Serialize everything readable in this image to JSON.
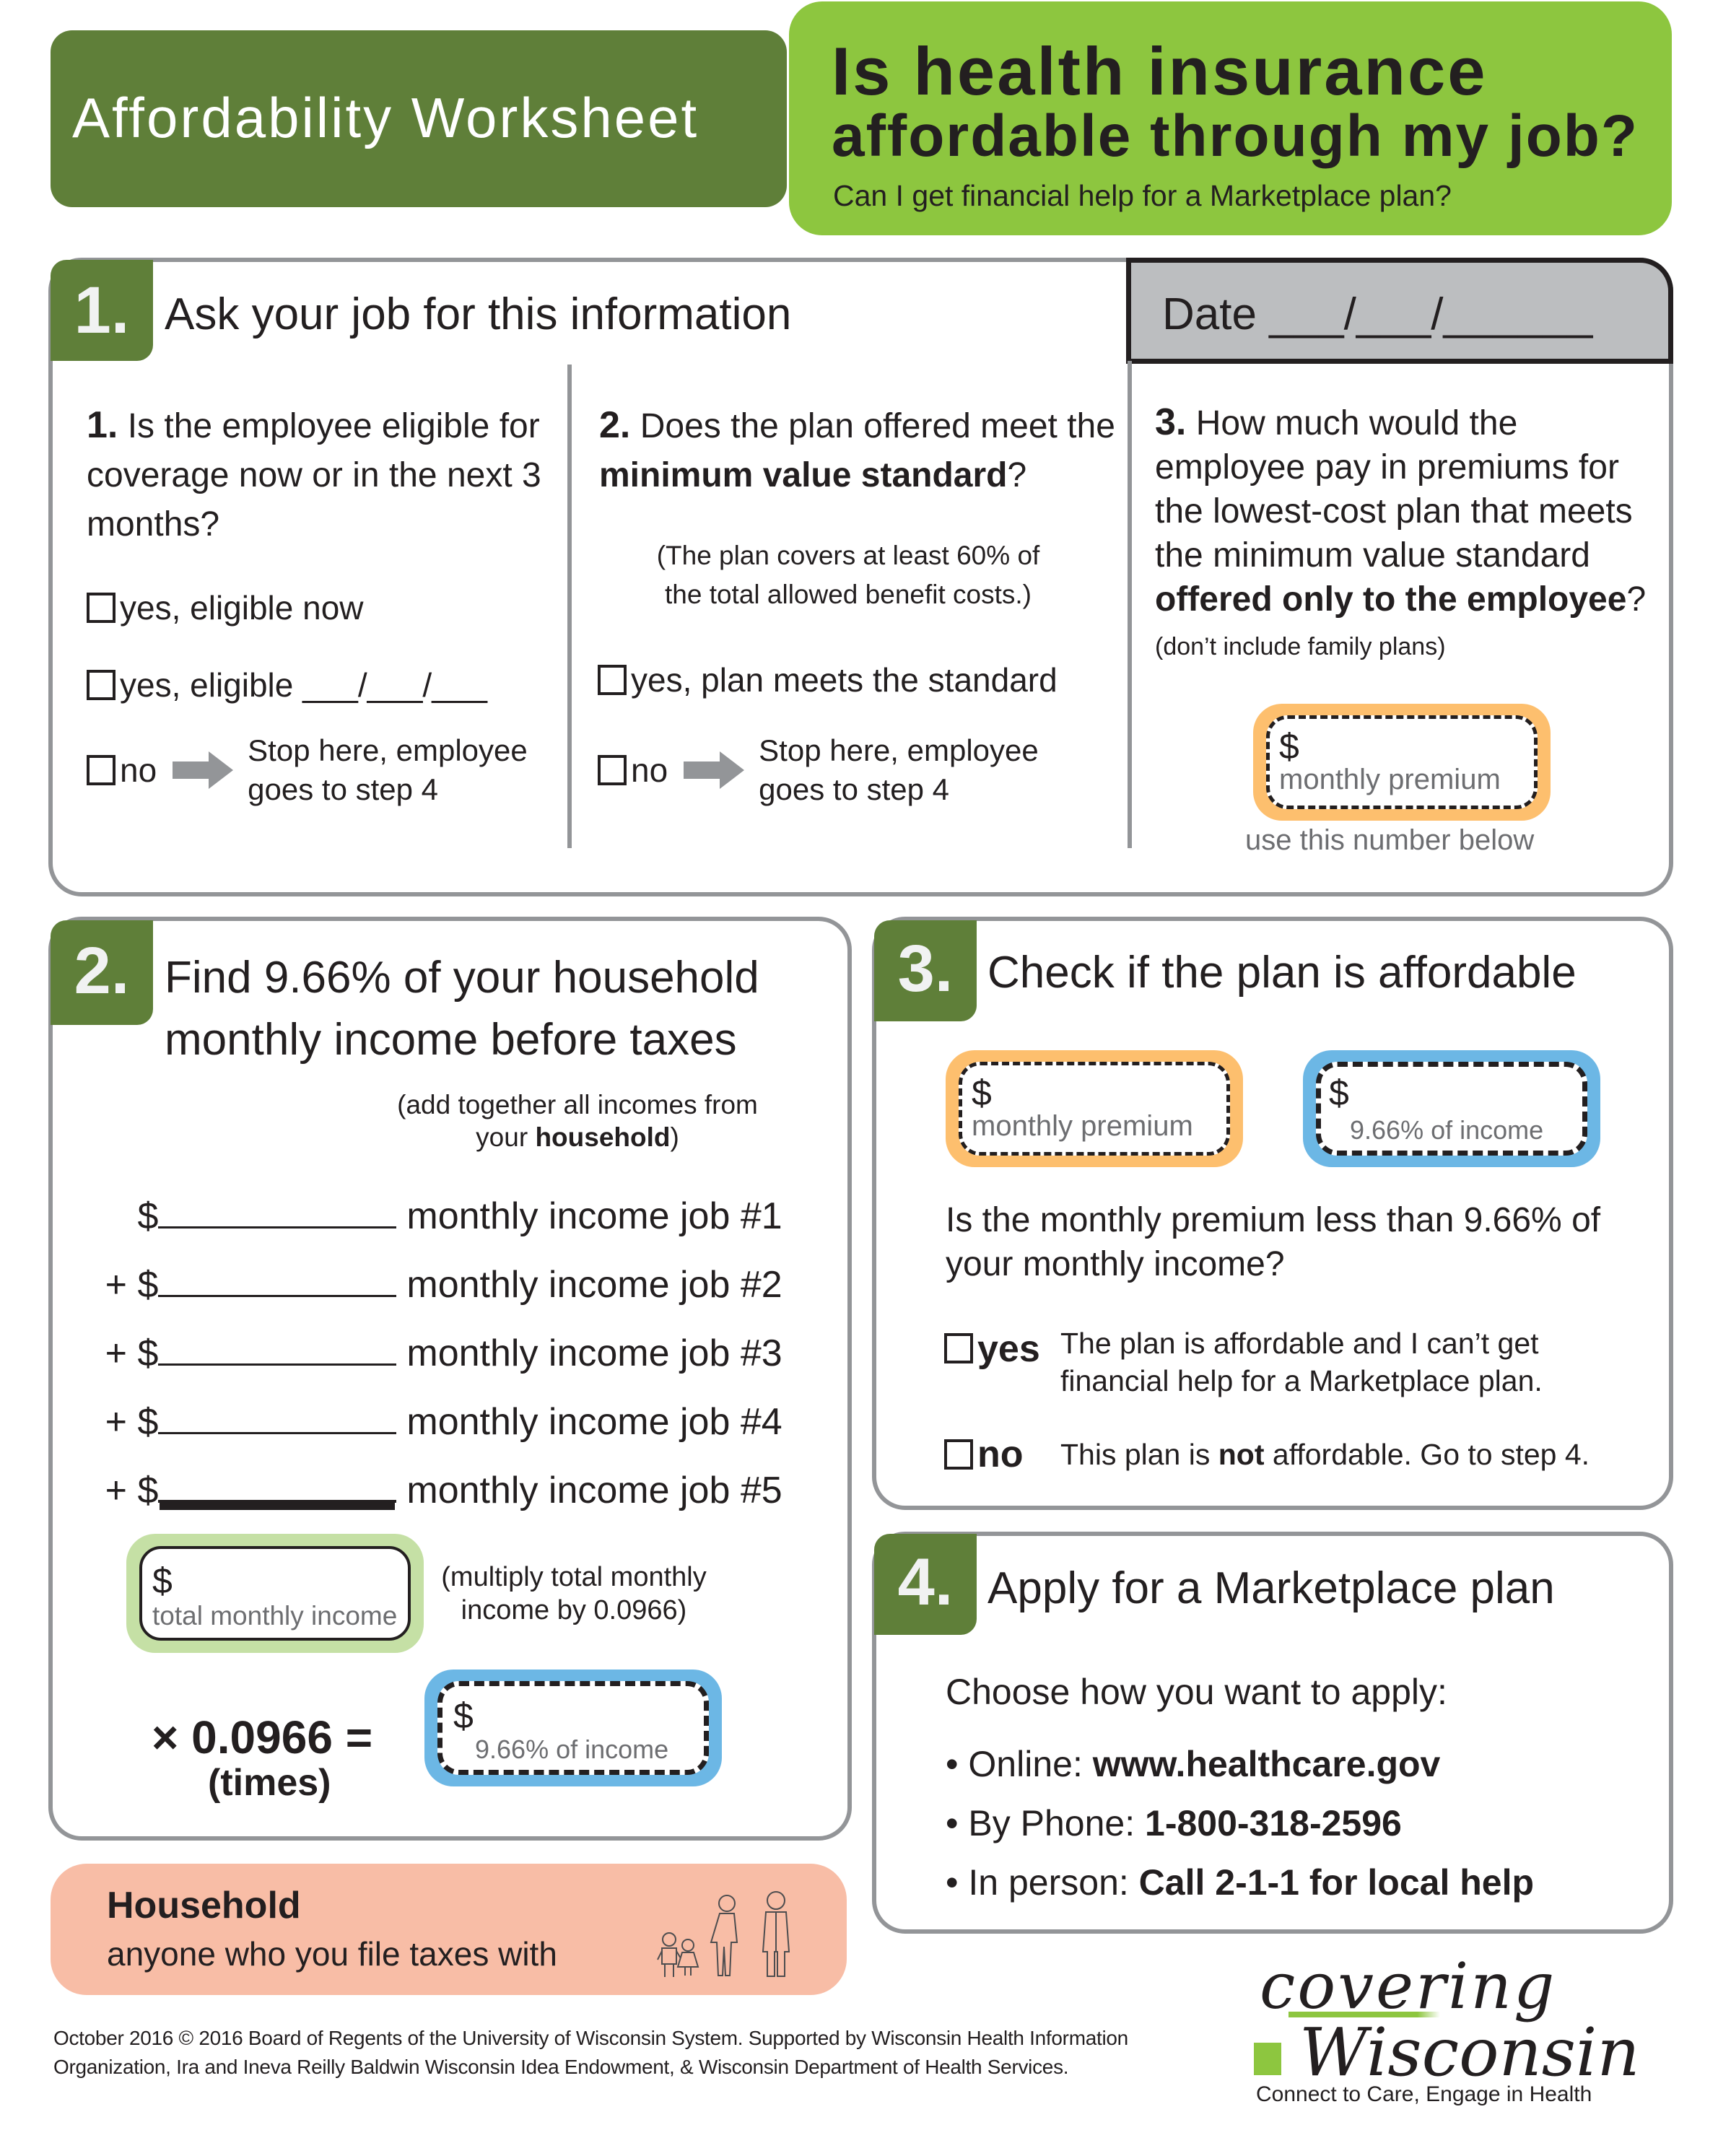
{
  "header": {
    "worksheet_title": "Affordability Worksheet",
    "question_line1": "Is health insurance",
    "question_line2": "affordable through my job?",
    "subtitle": "Can I get financial help for a Marketplace plan?"
  },
  "colors": {
    "dark_green": "#5f7f39",
    "light_green": "#8dc63f",
    "orange": "#fdbf6e",
    "blue": "#6cb7e5",
    "pale_green": "#c5e0a5",
    "salmon": "#f8bda6",
    "gray_border": "#939598",
    "date_gray": "#bcbec0"
  },
  "step1": {
    "number": "1.",
    "title": "Ask your job for this information",
    "date_label": "Date ___/___/______",
    "q1": {
      "num": "1.",
      "text": "Is the employee eligible for coverage now or in the next 3 months?",
      "options": [
        "yes, eligible now",
        "yes, eligible ___/___/___",
        "no"
      ],
      "stop_text": "Stop here, employee goes to step 4"
    },
    "q2": {
      "num": "2.",
      "text_pre": "Does the plan offered meet the ",
      "text_bold": "minimum value standard",
      "text_post": "?",
      "note": "(The plan covers at least 60% of the total allowed benefit costs.)",
      "options": [
        "yes, plan meets the standard",
        "no"
      ],
      "stop_text": "Stop here, employee goes to step 4"
    },
    "q3": {
      "num": "3.",
      "text_pre": "How much would the employee pay in premiums for the lowest-cost plan that meets the minimum value standard ",
      "text_bold": "offered only to the employee",
      "text_post": "?",
      "note": "(don’t include family plans)",
      "field_dollar": "$",
      "field_label": "monthly premium",
      "hint": "use this number below"
    }
  },
  "step2": {
    "number": "2.",
    "title_line1": "Find 9.66% of your household",
    "title_line2": "monthly income before taxes",
    "note_pre": "(add together all incomes from your ",
    "note_bold": "household",
    "note_post": ")",
    "income_rows": [
      {
        "prefix": "",
        "label": "monthly income job #1"
      },
      {
        "prefix": "+",
        "label": "monthly income job #2"
      },
      {
        "prefix": "+",
        "label": "monthly income job #3"
      },
      {
        "prefix": "+",
        "label": "monthly income job #4"
      },
      {
        "prefix": "+",
        "label": "monthly income job #5"
      }
    ],
    "dollar": "$",
    "total_label": "total monthly income",
    "multiply_note": "(multiply total monthly income by 0.0966)",
    "multiplier": "× 0.0966 =",
    "times": "(times)",
    "result_label": "9.66% of income"
  },
  "step3": {
    "number": "3.",
    "title": "Check if the plan is affordable",
    "premium_label": "monthly premium",
    "income_label": "9.66% of income",
    "dollar": "$",
    "question": "Is the monthly premium less than 9.66% of your monthly income?",
    "yes_label": "yes",
    "yes_text": "The plan is affordable and I can’t get financial help for a Marketplace plan.",
    "no_label": "no",
    "no_text_pre": "This plan is ",
    "no_text_bold": "not",
    "no_text_post": " affordable. Go to step 4."
  },
  "step4": {
    "number": "4.",
    "title": "Apply for a Marketplace plan",
    "intro": "Choose how you want to apply:",
    "options": [
      {
        "label": "Online: ",
        "value": "www.healthcare.gov"
      },
      {
        "label": "By Phone: ",
        "value": "1-800-318-2596"
      },
      {
        "label": "In person: ",
        "value": "Call 2-1-1 for local help"
      }
    ]
  },
  "household": {
    "title": "Household",
    "definition": "anyone who you file taxes with"
  },
  "footer": {
    "line1": "October 2016 © 2016 Board of Regents of the University of Wisconsin System. Supported by Wisconsin Health Information",
    "line2": "Organization, Ira and Ineva Reilly Baldwin Wisconsin Idea Endowment, & Wisconsin Department of Health Services."
  },
  "logo": {
    "word1": "covering",
    "word2": "Wisconsin",
    "tagline": "Connect to Care, Engage in Health"
  }
}
